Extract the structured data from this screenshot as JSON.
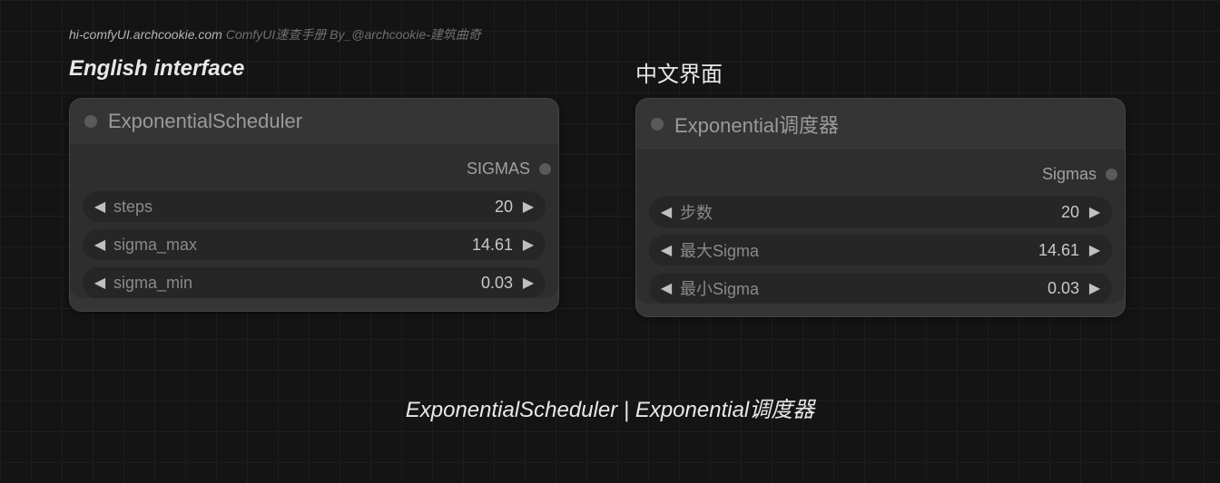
{
  "watermark": {
    "url": "hi-comfyUI.archcookie.com",
    "text": "ComfyUI速查手册 By_@archcookie-建筑曲奇"
  },
  "headings": {
    "left": "English interface",
    "right": "中文界面"
  },
  "nodes": {
    "en": {
      "title": "ExponentialScheduler",
      "output": "SIGMAS",
      "widgets": [
        {
          "label": "steps",
          "value": "20"
        },
        {
          "label": "sigma_max",
          "value": "14.61"
        },
        {
          "label": "sigma_min",
          "value": "0.03"
        }
      ]
    },
    "zh": {
      "title": "Exponential调度器",
      "output": "Sigmas",
      "widgets": [
        {
          "label": "步数",
          "value": "20"
        },
        {
          "label": "最大Sigma",
          "value": "14.61"
        },
        {
          "label": "最小Sigma",
          "value": "0.03"
        }
      ]
    }
  },
  "caption": "ExponentialScheduler | Exponential调度器"
}
